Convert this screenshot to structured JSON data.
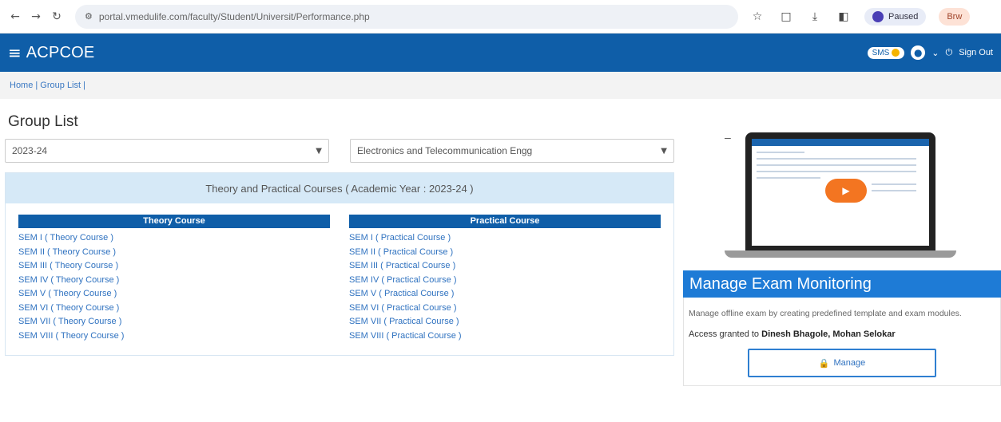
{
  "browser": {
    "url": "portal.vmedulife.com/faculty/Student/Universit/Performance.php",
    "profile_label": "Paused",
    "browse_label": "Brw"
  },
  "header": {
    "title": "ACPCOE",
    "sms_label": "SMS",
    "sign_out": "Sign Out"
  },
  "breadcrumb": "Home | Group List |",
  "page_title": "Group List",
  "filters": {
    "year": "2023-24",
    "department": "Electronics and Telecommunication Engg"
  },
  "panel": {
    "heading": "Theory and Practical Courses ( Academic Year : 2023-24 )",
    "theory": {
      "heading": "Theory Course",
      "items": [
        "SEM I ( Theory Course )",
        "SEM II ( Theory Course )",
        "SEM III ( Theory Course )",
        "SEM IV ( Theory Course )",
        "SEM V ( Theory Course )",
        "SEM VI ( Theory Course )",
        "SEM VII ( Theory Course )",
        "SEM VIII ( Theory Course )"
      ]
    },
    "practical": {
      "heading": "Practical Course",
      "items": [
        "SEM I ( Practical Course )",
        "SEM II ( Practical Course )",
        "SEM III ( Practical Course )",
        "SEM IV ( Practical Course )",
        "SEM V ( Practical Course )",
        "SEM VI ( Practical Course )",
        "SEM VII ( Practical Course )",
        "SEM VIII ( Practical Course )"
      ]
    }
  },
  "exam": {
    "title": "Manage Exam Monitoring",
    "description": "Manage offline exam by creating predefined template and exam modules.",
    "access_prefix": "Access granted to",
    "access_names": "Dinesh Bhagole, Mohan Selokar",
    "manage_label": "Manage"
  },
  "colors": {
    "brand": "#0f5ea8",
    "exam_title": "#1e7bd6",
    "link": "#2f72c0"
  }
}
